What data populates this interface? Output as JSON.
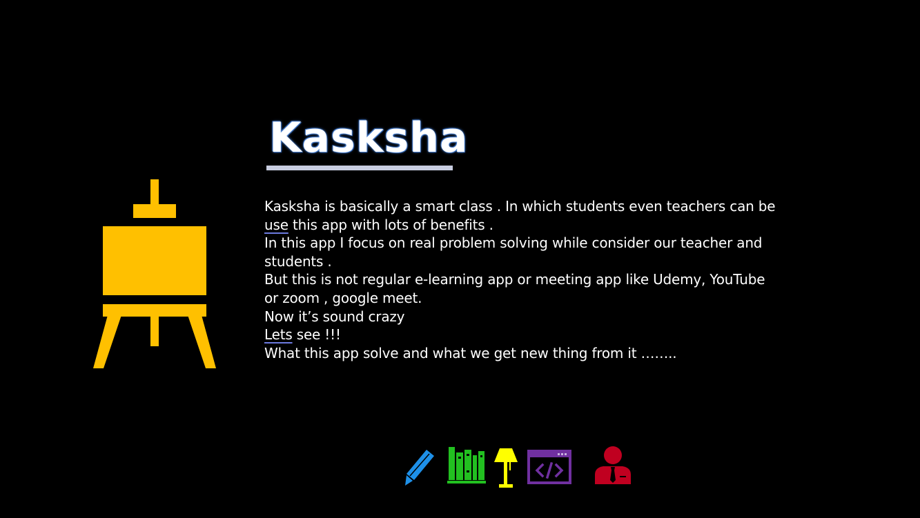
{
  "slide": {
    "background": "#000000",
    "title": "Kasksha",
    "title_color": "#ffffff",
    "paragraph": {
      "line1": "Kasksha is basically a smart class . In which students even teachers can be",
      "line2_marked": "use",
      "line2_rest": " this app with lots of benefits .",
      "line3": "In this app I focus on real problem solving while consider our teacher and",
      "line4": "students .",
      "line5": "But this is not regular e-learning app or meeting app like Udemy, YouTube",
      "line6": "or zoom , google meet.",
      "line7": "Now it’s sound crazy",
      "line8_marked": "Lets",
      "line8_rest": " see !!!",
      "line9": "What this app solve and what we get new thing from it ……..",
      "text_color": "#ffffff"
    }
  },
  "icons": {
    "easel": {
      "name": "easel-icon",
      "color": "#ffc000"
    },
    "pencil": {
      "name": "pencil-icon",
      "color": "#1e90e8"
    },
    "books": {
      "name": "books-icon",
      "color": "#22c020"
    },
    "lamp": {
      "name": "desk-lamp-icon",
      "color": "#ffff00"
    },
    "code": {
      "name": "code-window-icon",
      "color": "#7030a0"
    },
    "teacher": {
      "name": "teacher-icon",
      "color": "#c00020"
    }
  }
}
